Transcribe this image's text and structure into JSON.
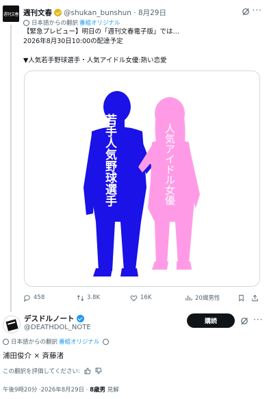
{
  "post1": {
    "avatar_text": "週刊文春",
    "display_name": "週刊文春",
    "handle_date": "@shukan_bunshun · 8月29日",
    "translated_prefix": "日本語からの翻訳",
    "translated_link": "番組オリジナル",
    "body_lines": [
      "【緊急プレビュー】明日の「週刊文春電子版」では…",
      "2026年8月30日10:00の配達予定",
      "",
      "▼人気若手野球選手・人気アイドル女優:熱い恋愛"
    ],
    "image": {
      "left_label": "若手人気野球選手",
      "right_label": "人気アイドル女優",
      "left_color": "#1a12e6",
      "right_color": "#ff9be6"
    },
    "actions": {
      "replies": "458",
      "reposts": "3.8K",
      "likes": "16K",
      "views": "20織男性"
    }
  },
  "post2": {
    "display_name": "デスドルノート",
    "handle": "@DEATHDOL_NOTE",
    "subscribe_label": "購読",
    "translated_prefix": "日本語からの翻訳",
    "translated_link": "番組オリジナル",
    "body": "浦田俊介 × 斉藤渚",
    "rate_prompt": "この翻訳を評価してください:",
    "meta_time": "午後9時20分 ·2026年8月29日 · ",
    "meta_views": "8歳男",
    "meta_suffix": " 見解"
  },
  "colors": {
    "accent": "#1d9bf0",
    "text": "#0f1419",
    "muted": "#536471",
    "border": "#cfd9de"
  }
}
